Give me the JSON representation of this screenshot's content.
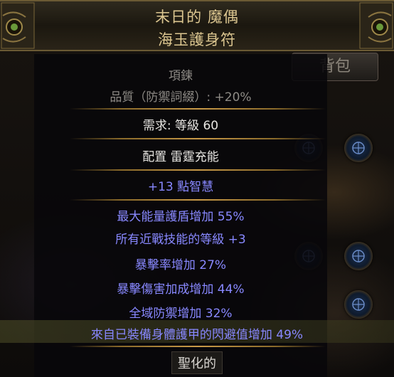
{
  "item": {
    "name": "末日的 魔偶",
    "base_type": "海玉護身符",
    "item_class": "項鍊",
    "quality": "品質（防禦詞綴）: +20%",
    "requirement": "需求: 等級 60",
    "implicit_1": "配置 雷霆充能",
    "implicit_2": "+13 點智慧",
    "mods": [
      "最大能量護盾增加 55%",
      "所有近戰技能的等級 +3",
      "暴擊率增加 27%",
      "暴擊傷害加成增加 44%",
      "全域防禦增加 32%",
      "來自已裝備身體護甲的閃避值增加 49%"
    ],
    "status": "聖化的"
  },
  "background": {
    "inventory_tab": "背包"
  },
  "colors": {
    "title": "#dcc690",
    "magic_mod": "#8888ff",
    "label": "#8d8a85",
    "value": "#e8e6e2",
    "separator": "#c99a48"
  }
}
